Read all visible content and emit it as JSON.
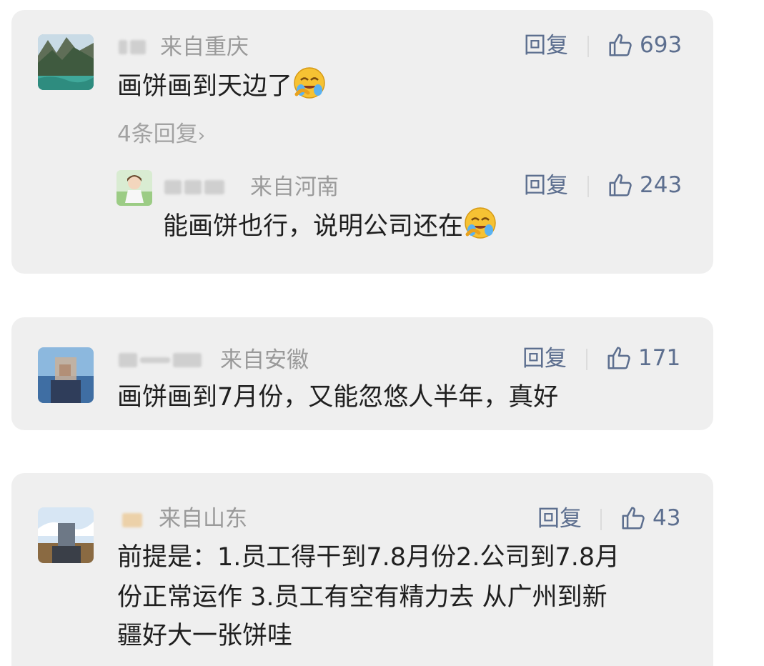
{
  "comments": [
    {
      "location": "来自重庆",
      "reply_label": "回复",
      "likes": "693",
      "text": "画饼画到天边了",
      "emoji": "facepalm-laugh-emoji",
      "more_replies": "4条回复",
      "reply": {
        "location": "来自河南",
        "reply_label": "回复",
        "likes": "243",
        "text": "能画饼也行，说明公司还在",
        "emoji": "facepalm-laugh-emoji"
      }
    },
    {
      "location": "来自安徽",
      "reply_label": "回复",
      "likes": "171",
      "text": "画饼画到7月份，又能忽悠人半年，真好"
    },
    {
      "location": "来自山东",
      "reply_label": "回复",
      "likes": "43",
      "text_lines": [
        "前提是：1.员工得干到7.8月份2.公司到7.8月",
        "份正常运作 3.员工有空有精力去 从广州到新",
        "疆好大一张饼哇"
      ]
    }
  ],
  "icons": {
    "like": "thumbs-up-icon",
    "chevron": "chevron-right-icon"
  },
  "colors": {
    "card_bg": "#efefef",
    "link_blue": "#5d6f8f",
    "muted_gray": "#9a9a9a",
    "text_dark": "#1f1f1f"
  }
}
